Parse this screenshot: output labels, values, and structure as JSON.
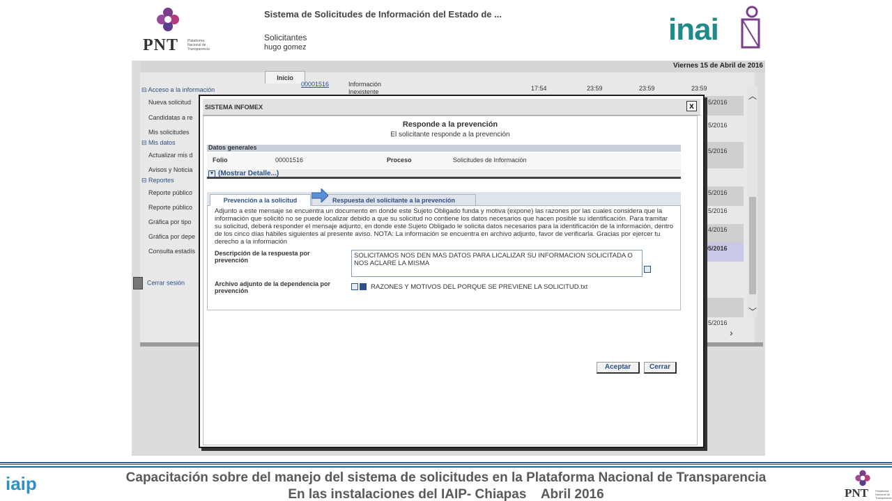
{
  "app": {
    "system_title": "Sistema de Solicitudes de Información del Estado de ...",
    "role": "Solicitantes",
    "user": "hugo gomez",
    "date": "Viernes 15 de Abril de 2016",
    "pnt_word": "PNT",
    "pnt_sub": "Plataforma Nacional de Transparencia",
    "inai_word": "inai"
  },
  "sidebar": {
    "sections": [
      {
        "label": "Acceso a la información",
        "items": [
          "Nueva solicitud",
          "Candidatas a re",
          "Mis solicitudes"
        ]
      },
      {
        "label": "Mis datos",
        "items": [
          "Actualizar mis d",
          "Avisos y Noticia"
        ]
      },
      {
        "label": "Reportes",
        "items": [
          "Reporte público",
          "Reporte público",
          "Gráfica por tipo",
          "Gráfica por depe",
          "Consulta estadís"
        ]
      }
    ],
    "logout": "Cerrar sesión"
  },
  "background": {
    "tab_inicio": "Inicio",
    "row_folio": "00001516",
    "row_status_line1": "Información",
    "row_status_line2": "Inexistente",
    "row_times": [
      "17:54",
      "23:59",
      "23:59",
      "23:59"
    ],
    "date_fragments": [
      "5/2016",
      "5/2016",
      "5/2016",
      "5/2016",
      "5/2016",
      "4/2016",
      "05/2016",
      "5/2016"
    ]
  },
  "modal": {
    "title": "SISTEMA INFOMEX",
    "close": "x",
    "heading": "Responde a la prevención",
    "subheading": "El solicitante responde a la prevención",
    "general_label": "Datos generales",
    "folio_label": "Folio",
    "folio_value": "00001516",
    "proceso_label": "Proceso",
    "proceso_value": "Solicitudes de Información",
    "show_details": "(Mostrar Detalle...)",
    "tabs": [
      "Prevención a la solicitud",
      "Respuesta del solicitante a la prevención"
    ],
    "body_text": "Adjunto a este mensaje se encuentra un documento en donde este Sujeto Obligado funda y motiva (expone) las razones por las cuales considera que la información que solicitó no se puede localizar debido a que su solicitud no contiene los datos necesarios que hacen posible su identificación. Para tramitar su solicitud, deberá responder el mensaje adjunto, en donde este Sujeto Obligado le solicita datos necesarios para la identificación de la información, dentro de los cinco días hábiles siguientes al presente aviso. NOTA: La información se encuentra en archivo adjunto, favor de verificarla. Gracias por ejercer tu derecho a la información",
    "response_label": "Descripción de la respuesta por prevención",
    "response_value": "SOLICITAMOS NOS DEN MAS DATOS PARA LICALIZAR SU INFORMACION SOLICITADA O NOS ACLARE LA MISMA",
    "attachment_label": "Archivo adjunto de la dependencia por prevención",
    "attachment_name": "RAZONES Y MOTIVOS DEL PORQUE SE PREVIENE LA SOLICITUD.txt",
    "accept": "Aceptar",
    "cancel": "Cerrar"
  },
  "footer": {
    "line1": "Capacitación sobre del manejo del sistema de solicitudes en la Plataforma Nacional de Transparencia",
    "line2": "En las instalaciones del IAIP- Chiapas    Abril 2016",
    "iaip_word": "iaip",
    "pnt_word": "PNT",
    "pnt_sub": "Plataforma Nacional de Transparencia"
  },
  "colors": {
    "accent_blue": "#2a4f8a",
    "footer_line": "#2a5fa8",
    "inai_teal": "#1e8a8a",
    "purple_logo": "#7a3d8c"
  }
}
